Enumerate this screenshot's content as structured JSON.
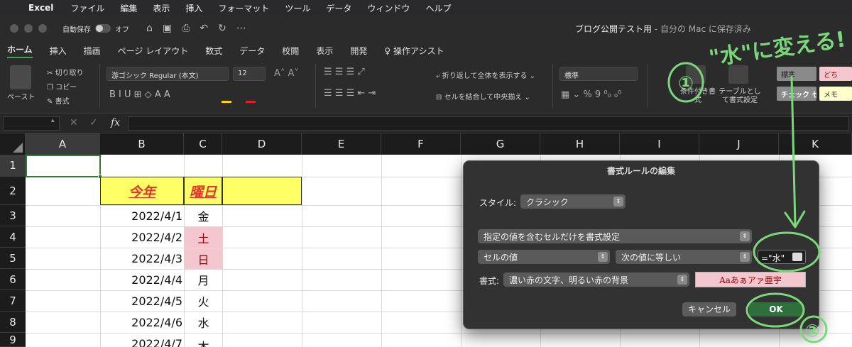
{
  "menubar": {
    "app": "Excel",
    "items": [
      "ファイル",
      "編集",
      "表示",
      "挿入",
      "フォーマット",
      "ツール",
      "データ",
      "ウィンドウ",
      "ヘルプ"
    ]
  },
  "titlebar": {
    "autosave_label": "自動保存",
    "autosave_state": "オフ",
    "doc_name": "ブログ公開テスト用",
    "doc_status": " - 自分の Mac に保存済み"
  },
  "ribbon_tabs": [
    "ホーム",
    "挿入",
    "描画",
    "ページ レイアウト",
    "数式",
    "データ",
    "校閲",
    "表示",
    "開発",
    "操作アシスト"
  ],
  "ribbon": {
    "paste": "ペースト",
    "cut": "切り取り",
    "copy": "コピー",
    "format_painter": "書式",
    "font_name": "游ゴシック Regular (本文)",
    "font_size": "12",
    "wrap_text": "折り返して全体を表示する",
    "merge_center": "セルを結合して中央揃え",
    "number_format": "標準",
    "conditional_format": "条件付き書式",
    "table_format": "テーブルとして書式設定",
    "style_normal": "標準",
    "style_check": "チェック セル",
    "style_bad": "どち",
    "style_memo": "メモ"
  },
  "formula_bar": {
    "fx": "fx",
    "cancel": "✕",
    "accept": "✓"
  },
  "sheet": {
    "columns": [
      "A",
      "B",
      "C",
      "D",
      "E",
      "F",
      "G",
      "H",
      "I",
      "J",
      "K"
    ],
    "rows": [
      "1",
      "2",
      "3",
      "4",
      "5",
      "6",
      "7",
      "8",
      "9"
    ],
    "header_b": "今年",
    "header_c": "曜日",
    "dates": [
      "2022/4/1",
      "2022/4/2",
      "2022/4/3",
      "2022/4/4",
      "2022/4/5",
      "2022/4/6",
      "2022/4/7"
    ],
    "weekdays": [
      "金",
      "土",
      "日",
      "月",
      "火",
      "水",
      "木"
    ],
    "colors": {
      "header_fill": "#ffff66",
      "header_text": "#e6352b",
      "weekend_fill": "#f4c7ce",
      "weekend_text": "#9c0006"
    }
  },
  "dialog": {
    "title": "書式ルールの編集",
    "style_label": "スタイル:",
    "style_value": "クラシック",
    "rule_type": "指定の値を含むセルだけを書式設定",
    "condition_1": "セルの値",
    "condition_2": "次の値に等しい",
    "value_input": "=\"水\"",
    "format_label": "書式:",
    "format_value": "濃い赤の文字、明るい赤の背景",
    "preview": "Aaあぁアァ亜宇",
    "cancel": "キャンセル",
    "ok": "OK"
  },
  "annotations": {
    "note": "\"水\"に変える!",
    "step1": "①",
    "step2": "②",
    "color": "#7ad77a"
  }
}
